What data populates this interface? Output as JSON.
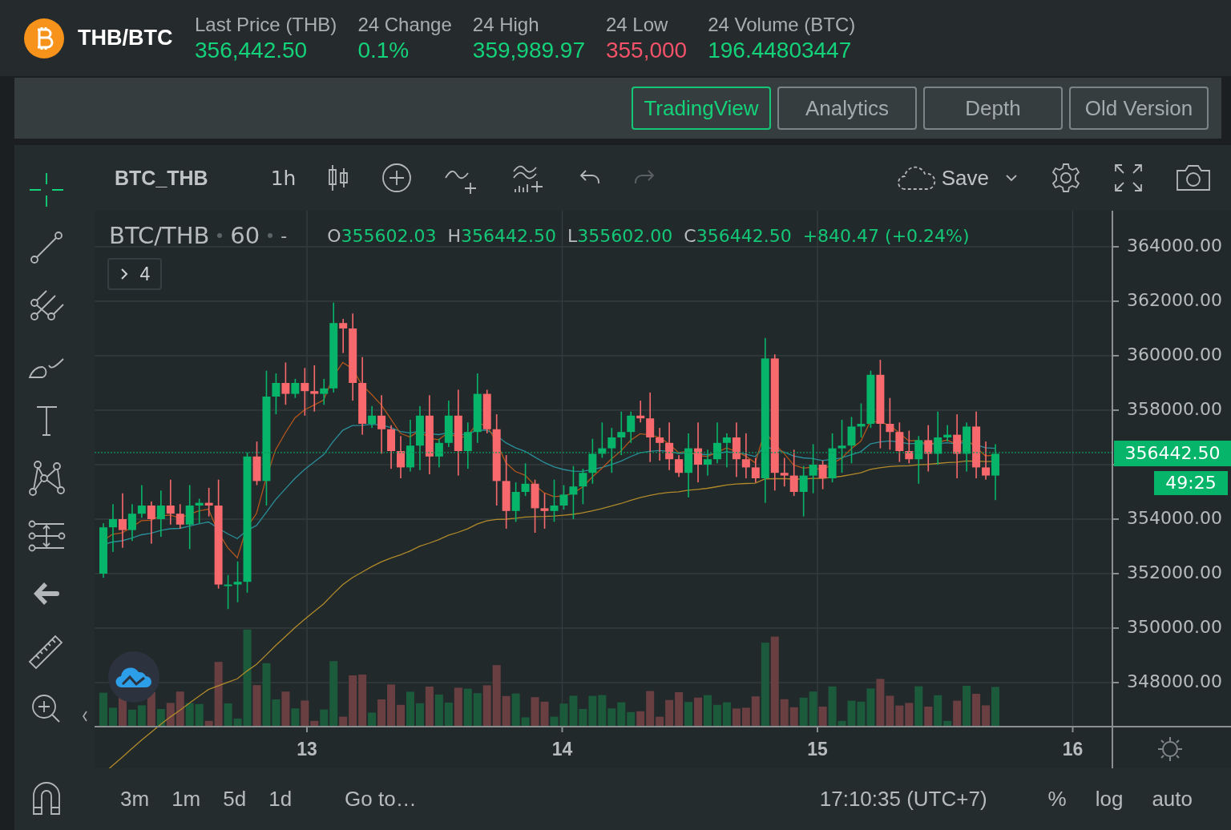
{
  "header": {
    "pair": "THB/BTC",
    "stats": [
      {
        "label": "Last Price (THB)",
        "value": "356,442.50",
        "color": "#14d27a"
      },
      {
        "label": "24 Change",
        "value": "0.1%",
        "color": "#14d27a"
      },
      {
        "label": "24 High",
        "value": "359,989.97",
        "color": "#14d27a"
      },
      {
        "label": "24 Low",
        "value": "355,000",
        "color": "#f45269"
      },
      {
        "label": "24 Volume (BTC)",
        "value": "196.44803447",
        "color": "#14d27a"
      }
    ]
  },
  "view_tabs": [
    {
      "label": "TradingView",
      "selected": true
    },
    {
      "label": "Analytics",
      "selected": false
    },
    {
      "label": "Depth",
      "selected": false
    },
    {
      "label": "Old Version",
      "selected": false
    }
  ],
  "toolbar": {
    "symbol": "BTC_THB",
    "interval": "1h",
    "save": "Save"
  },
  "drawing_tools": [
    {
      "kind": "crosshair",
      "selected": true
    },
    {
      "kind": "trend-line",
      "selected": false
    },
    {
      "kind": "pitchfork",
      "selected": false
    },
    {
      "kind": "brush",
      "selected": false
    },
    {
      "kind": "text",
      "selected": false
    },
    {
      "kind": "pattern",
      "selected": false
    },
    {
      "kind": "measure",
      "selected": false
    },
    {
      "kind": "arrow",
      "selected": false
    },
    {
      "kind": "ruler",
      "selected": false
    },
    {
      "kind": "zoom",
      "selected": false
    }
  ],
  "legend": {
    "symbol": "BTC/THB",
    "interval": "60",
    "dash": "-",
    "ohlc": [
      {
        "label": "O",
        "value": "355602.03"
      },
      {
        "label": "H",
        "value": "356442.50"
      },
      {
        "label": "L",
        "value": "355602.00"
      },
      {
        "label": "C",
        "value": "356442.50"
      }
    ],
    "change": "+840.47 (+0.24%)",
    "hidden_count": "4"
  },
  "price_axis": {
    "ticks": [
      "364000.00",
      "362000.00",
      "360000.00",
      "358000.00",
      "354000.00",
      "352000.00",
      "350000.00",
      "348000.00"
    ],
    "last_price": "356442.50",
    "countdown": "49:25"
  },
  "time_axis": {
    "ticks": [
      "13",
      "14",
      "15",
      "16"
    ]
  },
  "bottom_bar": {
    "ranges": [
      "3m",
      "1m",
      "5d",
      "1d"
    ],
    "goto": "Go to…",
    "time": "17:10:35 (UTC+7)",
    "options": [
      "%",
      "log",
      "auto"
    ]
  }
}
